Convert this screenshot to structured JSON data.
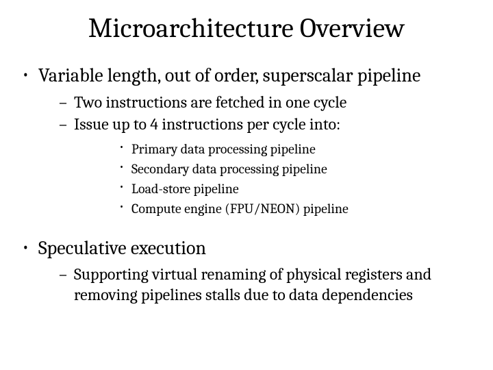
{
  "title": "Microarchitecture Overview",
  "bullets": [
    {
      "text": "Variable length, out of order, superscalar pipeline",
      "sub": [
        {
          "text": "Two instructions are fetched in one cycle"
        },
        {
          "text": "Issue up to 4 instructions per cycle into:",
          "sub": [
            {
              "text": "Primary data processing pipeline"
            },
            {
              "text": "Secondary data processing pipeline"
            },
            {
              "text": "Load-store pipeline"
            },
            {
              "text": "Compute engine (FPU/NEON) pipeline"
            }
          ]
        }
      ]
    },
    {
      "text": "Speculative execution",
      "sub": [
        {
          "text": "Supporting virtual renaming of physical registers and removing pipelines stalls due to data dependencies"
        }
      ]
    }
  ]
}
